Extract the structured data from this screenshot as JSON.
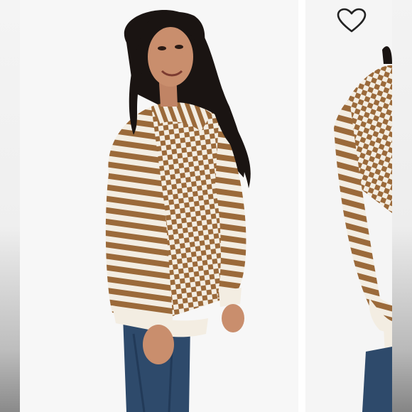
{
  "listing": {
    "like_button_label": "",
    "active_slide": 1,
    "slide_count": 2
  },
  "icons": {
    "like": "heart-outline-icon"
  },
  "colors": {
    "background": "#f7f7f7",
    "sweater_brown": "#9b6a3a",
    "sweater_cream": "#f3ede2",
    "denim": "#2e4a6b",
    "hair": "#1a1412",
    "skin": "#c98e6d",
    "heart_stroke": "#222222"
  }
}
